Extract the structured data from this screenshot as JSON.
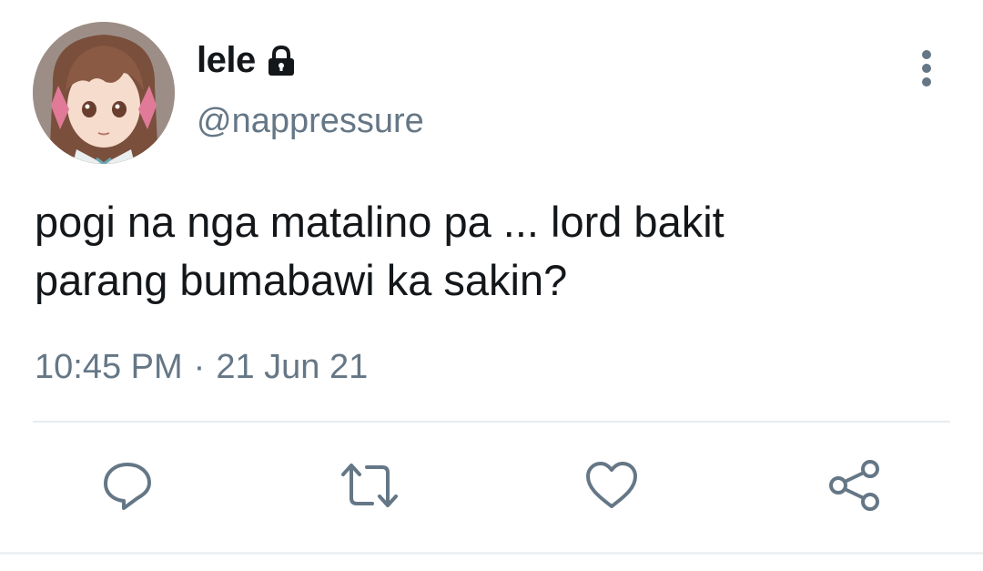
{
  "tweet": {
    "author": {
      "display_name": "lele",
      "handle": "@nappressure",
      "protected_icon": "lock-icon",
      "avatar": "anime-girl-avatar"
    },
    "text_lines": [
      "pogi na nga matalino pa ... lord bakit",
      "parang bumabawi ka sakin?"
    ],
    "time": "10:45 PM",
    "separator": "·",
    "date": "21 Jun 21",
    "menu_icon": "more-vertical-icon",
    "actions": [
      {
        "name": "reply",
        "icon": "reply-icon"
      },
      {
        "name": "retweet",
        "icon": "retweet-icon"
      },
      {
        "name": "like",
        "icon": "heart-icon"
      },
      {
        "name": "share",
        "icon": "share-icon"
      }
    ]
  },
  "colors": {
    "text_primary": "#14171a",
    "text_secondary": "#657786",
    "divider": "#e6ecf0"
  }
}
